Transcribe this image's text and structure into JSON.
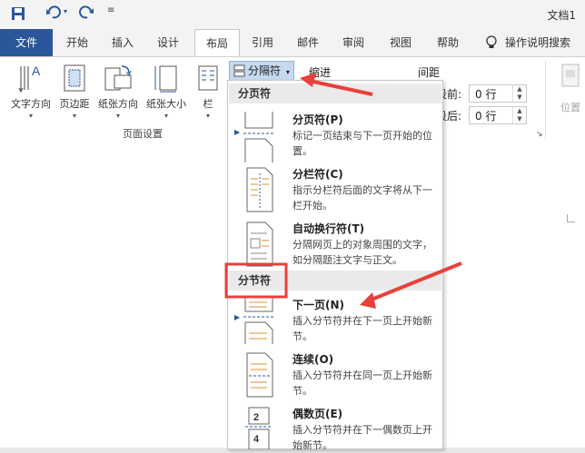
{
  "app": {
    "doc_title": "文档1"
  },
  "tabs": [
    {
      "id": "file",
      "label": "文件"
    },
    {
      "id": "home",
      "label": "开始"
    },
    {
      "id": "insert",
      "label": "插入"
    },
    {
      "id": "design",
      "label": "设计"
    },
    {
      "id": "layout",
      "label": "布局"
    },
    {
      "id": "references",
      "label": "引用"
    },
    {
      "id": "mailings",
      "label": "邮件"
    },
    {
      "id": "review",
      "label": "审阅"
    },
    {
      "id": "view",
      "label": "视图"
    },
    {
      "id": "help",
      "label": "帮助"
    },
    {
      "id": "tellme",
      "label": "操作说明搜索"
    }
  ],
  "ribbon": {
    "text_direction": "文字方向",
    "margins": "页边距",
    "orientation": "纸张方向",
    "size": "纸张大小",
    "columns": "栏",
    "breaks": "分隔符",
    "group_page_setup": "页面设置",
    "indent": "缩进",
    "spacing": "间距",
    "spacing_before_label": "段前:",
    "spacing_before_value": "0 行",
    "spacing_after_label": "段后:",
    "spacing_after_value": "0 行",
    "position": "位置"
  },
  "dropdown": {
    "section_page": "分页符",
    "section_section": "分节符",
    "items": [
      {
        "title": "分页符(P)",
        "desc": "标记一页结束与下一页开始的位置。"
      },
      {
        "title": "分栏符(C)",
        "desc": "指示分栏符后面的文字将从下一栏开始。"
      },
      {
        "title": "自动换行符(T)",
        "desc": "分隔网页上的对象周围的文字，如分隔题注文字与正文。"
      },
      {
        "title": "下一页(N)",
        "desc": "插入分节符并在下一页上开始新节。"
      },
      {
        "title": "连续(O)",
        "desc": "插入分节符并在同一页上开始新节。"
      },
      {
        "title": "偶数页(E)",
        "desc": "插入分节符并在下一偶数页上开始新节。"
      }
    ]
  },
  "colors": {
    "accent": "#2b579a",
    "annotation": "#e8403d"
  },
  "icons": [
    "save-icon",
    "undo-icon",
    "redo-icon",
    "customize-icon",
    "lightbulb-icon"
  ]
}
